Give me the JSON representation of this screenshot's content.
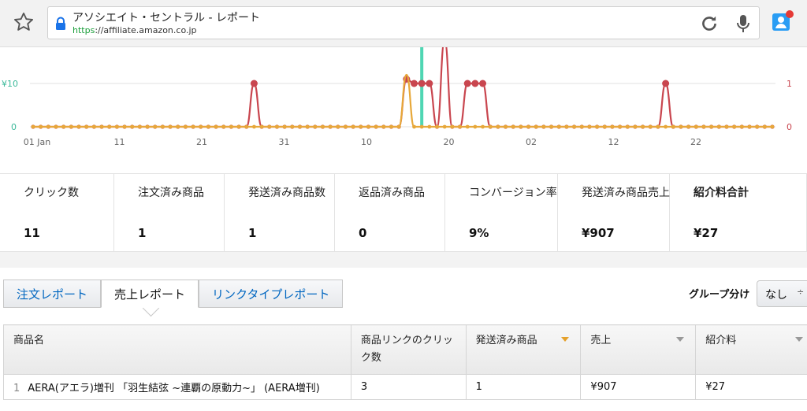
{
  "browser": {
    "page_title": "アソシエイト・セントラル - レポート",
    "url_scheme": "https",
    "url_rest": "://affiliate.amazon.co.jp",
    "colors": {
      "https": "#1a9e3a",
      "notification_dot": "#e53935",
      "profile_bg": "#2a9df4"
    }
  },
  "chart_data": {
    "type": "line",
    "x_tick_labels": [
      "01 Jan",
      "11",
      "21",
      "31",
      "10",
      "20",
      "02",
      "12",
      "22"
    ],
    "y_left_ticks": [
      "¥10",
      "0"
    ],
    "y_right_ticks": [
      "1",
      "0"
    ],
    "marker_day": 51,
    "series": [
      {
        "name": "",
        "color": "#c9464f",
        "values": [
          0,
          0,
          0,
          0,
          0,
          0,
          0,
          0,
          0,
          0,
          0,
          0,
          0,
          0,
          0,
          0,
          0,
          0,
          0,
          0,
          0,
          0,
          0,
          0,
          0,
          0,
          0,
          0,
          0,
          1,
          0,
          0,
          0,
          0,
          0,
          0,
          0,
          0,
          0,
          0,
          0,
          0,
          0,
          0,
          0,
          0,
          0,
          0,
          0,
          1.1,
          1,
          1,
          1,
          0,
          2,
          0,
          0,
          1,
          1,
          1,
          0,
          0,
          0,
          0,
          0,
          0,
          0,
          0,
          0,
          0,
          0,
          0,
          0,
          0,
          0,
          0,
          0,
          0,
          0,
          0,
          0,
          0,
          0,
          1,
          0,
          0,
          0,
          0,
          0,
          0,
          0,
          0,
          0,
          0,
          0,
          0,
          0,
          0
        ]
      },
      {
        "name": "",
        "color": "#e7a83a",
        "values": [
          0,
          0,
          0,
          0,
          0,
          0,
          0,
          0,
          0,
          0,
          0,
          0,
          0,
          0,
          0,
          0,
          0,
          0,
          0,
          0,
          0,
          0,
          0,
          0,
          0,
          0,
          0,
          0,
          0,
          0,
          0,
          0,
          0,
          0,
          0,
          0,
          0,
          0,
          0,
          0,
          0,
          0,
          0,
          0,
          0,
          0,
          0,
          0,
          0,
          1.2,
          0,
          0,
          0,
          0,
          0,
          0,
          0,
          0,
          0,
          0,
          0,
          0,
          0,
          0,
          0,
          0,
          0,
          0,
          0,
          0,
          0,
          0,
          0,
          0,
          0,
          0,
          0,
          0,
          0,
          0,
          0,
          0,
          0,
          0,
          0,
          0,
          0,
          0,
          0,
          0,
          0,
          0,
          0,
          0,
          0,
          0,
          0,
          0
        ]
      }
    ],
    "colors": {
      "left_axis": "#3cb99a",
      "right_axis": "#c9464f",
      "marker": "#4fd6b3"
    }
  },
  "stats": [
    {
      "label": "クリック数",
      "value": "11",
      "bold": false
    },
    {
      "label": "注文済み商品",
      "value": "1",
      "bold": false
    },
    {
      "label": "発送済み商品数",
      "value": "1",
      "bold": false
    },
    {
      "label": "返品済み商品",
      "value": "0",
      "bold": false
    },
    {
      "label": "コンバージョン率",
      "value": "9%",
      "bold": false
    },
    {
      "label": "発送済み商品売上",
      "value": "¥907",
      "bold": false
    },
    {
      "label": "紹介料合計",
      "value": "¥27",
      "bold": true
    }
  ],
  "tabs": [
    {
      "label": "注文レポート",
      "active": false
    },
    {
      "label": "売上レポート",
      "active": true
    },
    {
      "label": "リンクタイプレポート",
      "active": false
    }
  ],
  "group": {
    "label": "グループ分け",
    "selected": "なし"
  },
  "table": {
    "headers": [
      "商品名",
      "商品リンクのクリック数",
      "発送済み商品",
      "売上",
      "紹介料"
    ],
    "rows": [
      {
        "num": "1",
        "name": "AERA(アエラ)増刊 「羽生結弦 ~連覇の原動力~」 (AERA増刊)",
        "clicks": "3",
        "shipped": "1",
        "sales": "¥907",
        "fee": "¥27"
      }
    ]
  }
}
